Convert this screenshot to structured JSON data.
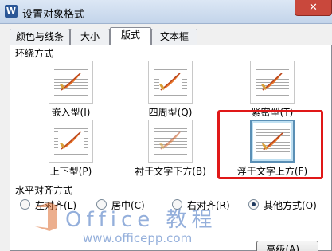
{
  "window": {
    "title": "设置对象格式",
    "app_icon": "W",
    "close_symbol": "✕"
  },
  "tabs": [
    {
      "label": "颜色与线条",
      "active": false
    },
    {
      "label": "大小",
      "active": false
    },
    {
      "label": "版式",
      "active": true
    },
    {
      "label": "文本框",
      "active": false
    }
  ],
  "wrap_section": {
    "title": "环绕方式",
    "options": [
      {
        "label": "嵌入型(I)",
        "selected": false
      },
      {
        "label": "四周型(Q)",
        "selected": false
      },
      {
        "label": "紧密型(T)",
        "selected": false
      },
      {
        "label": "上下型(P)",
        "selected": false
      },
      {
        "label": "衬于文字下方(B)",
        "selected": false
      },
      {
        "label": "浮于文字上方(F)",
        "selected": true
      }
    ]
  },
  "align_section": {
    "title": "水平对齐方式",
    "options": [
      {
        "label": "左对齐(L)",
        "checked": false
      },
      {
        "label": "居中(C)",
        "checked": false
      },
      {
        "label": "右对齐(R)",
        "checked": false
      },
      {
        "label": "其他方式(O)",
        "checked": true
      }
    ]
  },
  "watermark": {
    "text": "Office 教程",
    "url": "www.officepp.com"
  },
  "buttons": {
    "advanced": "高级(A)..."
  },
  "colors": {
    "highlight": "#e01818",
    "selected_border": "#5a8fb5",
    "pen_orange": "#e8752a"
  }
}
